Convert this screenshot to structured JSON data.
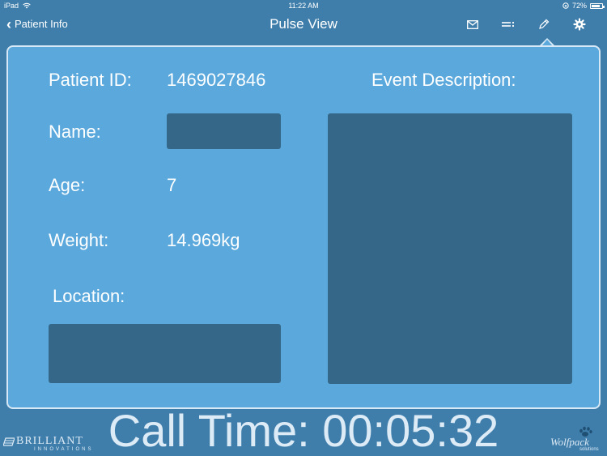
{
  "status_bar": {
    "device": "iPad",
    "time": "11:22 AM",
    "battery": "72%"
  },
  "nav": {
    "back_label": "Patient Info",
    "title": "Pulse View",
    "icons": [
      "envelope-icon",
      "sliders-icon",
      "pencil-icon",
      "gear-icon"
    ]
  },
  "form": {
    "patient_id_label": "Patient ID:",
    "patient_id_value": "1469027846",
    "name_label": "Name:",
    "name_value": "",
    "age_label": "Age:",
    "age_value": "7",
    "weight_label": "Weight:",
    "weight_value": "14.969kg",
    "location_label": "Location:",
    "location_value": "",
    "event_description_label": "Event Description:",
    "event_description_value": ""
  },
  "call_time": "Call Time: 00:05:32",
  "logos": {
    "left_main": "BRILLIANT",
    "left_sub": "INNOVATIONS",
    "right_main": "Wolfpack",
    "right_sub": "solutions"
  },
  "colors": {
    "background": "#3f7eab",
    "panel": "#5aa8dc",
    "field": "#356789",
    "text": "#ffffff"
  }
}
